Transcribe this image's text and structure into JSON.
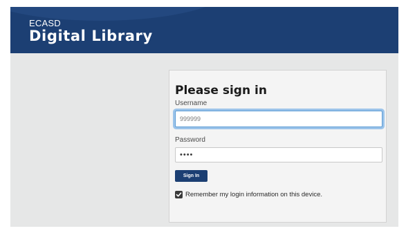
{
  "header": {
    "org": "ECASD",
    "title": "Digital Library"
  },
  "signin": {
    "heading": "Please sign in",
    "username_label": "Username",
    "username_value": "999999",
    "password_label": "Password",
    "password_value": "••••",
    "button_label": "Sign In",
    "remember_label": "Remember my login information on this device.",
    "remember_checked": true
  },
  "colors": {
    "brand": "#1c3f73",
    "focus_ring": "#9cc4ea",
    "page_bg": "#e6e7e7"
  }
}
